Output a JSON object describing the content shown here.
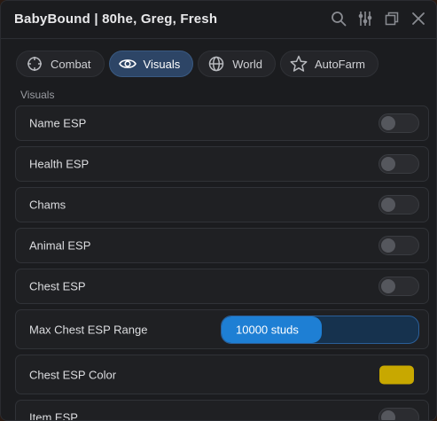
{
  "window": {
    "title": "BabyBound | 80he, Greg, Fresh"
  },
  "titlebar_icons": [
    "search-icon",
    "sliders-icon",
    "restore-icon",
    "close-icon"
  ],
  "tabs": [
    {
      "label": "Combat",
      "icon": "crosshair-icon",
      "active": false
    },
    {
      "label": "Visuals",
      "icon": "eye-icon",
      "active": true
    },
    {
      "label": "World",
      "icon": "globe-icon",
      "active": false
    },
    {
      "label": "AutoFarm",
      "icon": "star-icon",
      "active": false
    }
  ],
  "section": {
    "label": "Visuals"
  },
  "items": {
    "name_esp": {
      "label": "Name ESP",
      "enabled": false
    },
    "health_esp": {
      "label": "Health ESP",
      "enabled": false
    },
    "chams": {
      "label": "Chams",
      "enabled": false
    },
    "animal_esp": {
      "label": "Animal ESP",
      "enabled": false
    },
    "chest_esp": {
      "label": "Chest ESP",
      "enabled": false
    },
    "max_chest_range": {
      "label": "Max Chest ESP Range",
      "value_text": "10000 studs",
      "fill_fraction": 0.51
    },
    "chest_color": {
      "label": "Chest ESP Color",
      "color": "#c8a800"
    },
    "item_esp": {
      "label": "Item ESP",
      "enabled": false
    }
  },
  "colors": {
    "accent": "#1e7fd4",
    "active_tab": "#2d4566",
    "background": "#1b1c1f"
  }
}
